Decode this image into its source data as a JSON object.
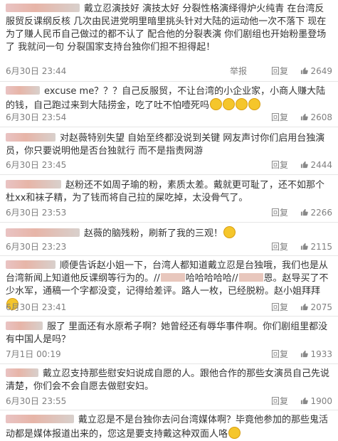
{
  "comments": [
    {
      "text": "戴立忍演技好 演技太好 分裂性格演绎得炉火纯青 在台湾反服贸反课纲反核 几次由民进党明里暗里挑头针对大陆的运动他一次不落下 现在为了赚人民币自己做过的都不认了 配合他的分裂表演 你们剧组也开始粉墨登场了 我就问一句 分裂国家支持台独你们担不担得起！",
      "time": "6月30日 23:44",
      "report": "举报",
      "reply": "回复",
      "likes": "2649"
    },
    {
      "text": "excuse me？？？自己反服贸，不让台湾的小企业家，小商人赚大陆的钱，自己跑过来到大陆捞金，吃了吐不怕噎死吗",
      "time": "6月30日 23:54",
      "reply": "回复",
      "likes": "2608"
    },
    {
      "text": "对赵薇特别失望 自始至终都没说到关键 网友声讨你们启用台独演员，你只要说明他是否台独就行 而不是指责网游",
      "time": "6月30日 23:45",
      "reply": "回复",
      "likes": "2444"
    },
    {
      "text": "赵粉还不如周子瑜的粉，素质太差。戴就更可耻了，还不如那个杜xx和袜子精，为了钱而将自己拉的屎吃掉，太没骨气了。",
      "time": "6月30日 23:53",
      "reply": "回复",
      "likes": "2266"
    },
    {
      "text": "赵薇的脑残粉，刷新了我的三观！",
      "time": "6月30日 23:23",
      "reply": "回复",
      "likes": "2115"
    },
    {
      "text_a": "顺便告诉赵小姐一下，台湾人都知道戴立忍是台独哦，我们也是从台湾新闻上知道他反课纲等行为的。//",
      "text_b": "哈哈哈哈哈//",
      "text_c": "恩。赵导买了不少水军，通稿一个字都没变，记得给差评。路人一枚，已经脱粉。赵小姐拜拜",
      "time": "6月30日 23:41",
      "reply": "回复",
      "likes": "2075"
    },
    {
      "text": "服了 里面还有水原希子啊？她曾经还有辱华事件啊。你们剧组里都没有中国人是吗？",
      "time": "7月1日 00:19",
      "reply": "回复",
      "likes": "1933"
    },
    {
      "text": "戴立忍支持那些慰安妇说成自愿的人。跟他合作的那些女演员自己先说清楚，你们会不会自愿去做慰安妇。",
      "time": "6月30日 23:55",
      "reply": "回复",
      "likes": "1900"
    },
    {
      "text": "戴立忍是不是台独你去问台湾媒体啊？毕竟他参加的那些鬼活动都是媒体报道出来的，您这是要支持戴这种双面人咯"
    }
  ],
  "icons": {
    "like": "thumbs-up-icon",
    "emoji": "smiley-emoji-icon"
  }
}
